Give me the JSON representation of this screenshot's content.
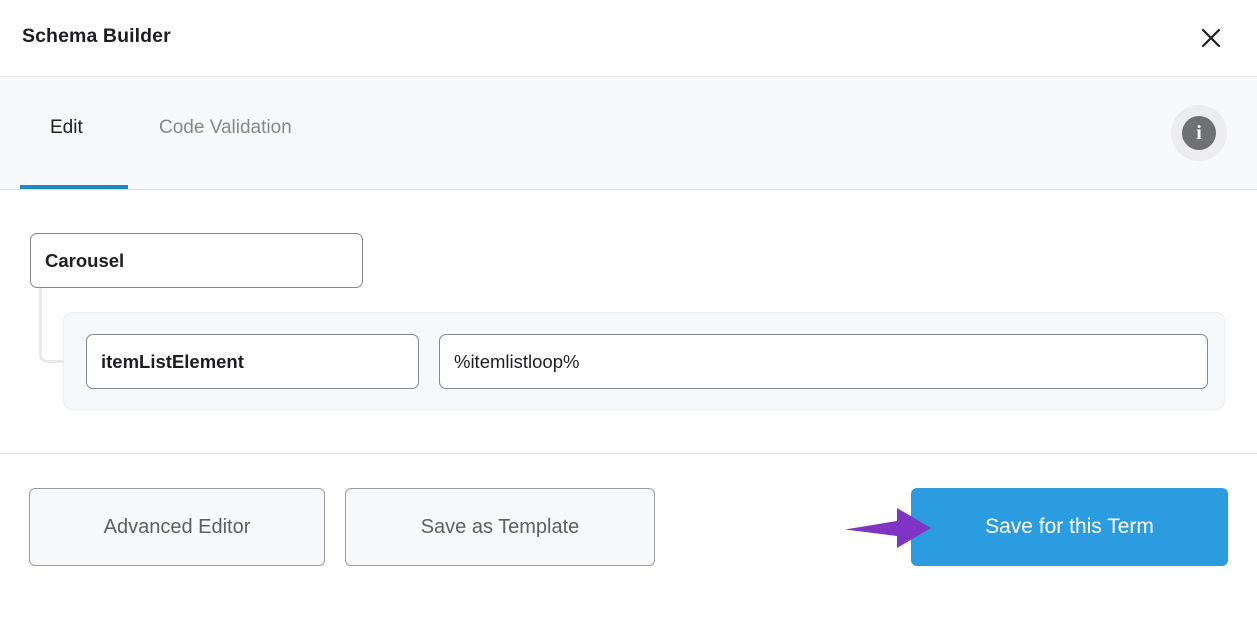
{
  "header": {
    "title": "Schema Builder",
    "close_label": "×",
    "close_icon": "close-icon"
  },
  "tabs": {
    "items": [
      {
        "label": "Edit",
        "active": true
      },
      {
        "label": "Code Validation",
        "active": false
      }
    ],
    "info_icon": "info-icon",
    "info_glyph": "i",
    "active_underline_color": "#2389c4"
  },
  "schema": {
    "root": {
      "value": "Carousel"
    },
    "child": {
      "key": "itemListElement",
      "value": "%itemlistloop%"
    }
  },
  "footer": {
    "advanced_editor_label": "Advanced Editor",
    "save_as_template_label": "Save as Template",
    "save_for_this_term_label": "Save for this Term",
    "primary_color": "#2b9ce0"
  },
  "annotation": {
    "arrow_icon": "arrow-right-icon",
    "arrow_color": "#7f34c3",
    "points_to": "Save for this Term"
  }
}
